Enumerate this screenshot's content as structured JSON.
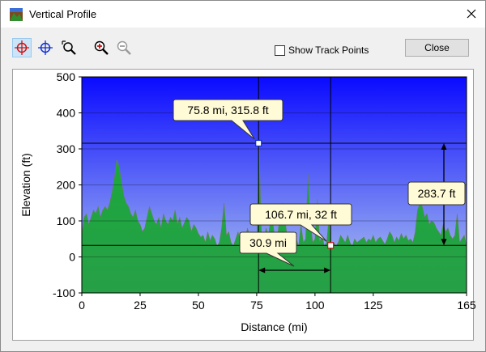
{
  "window": {
    "title": "Vertical Profile"
  },
  "toolbar": {
    "show_track_points_label": "Show Track Points",
    "close_label": "Close"
  },
  "chart_data": {
    "type": "area",
    "xlabel": "Distance   (mi)",
    "ylabel": "Elevation (ft)",
    "xlim": [
      0,
      165
    ],
    "ylim": [
      -100,
      500
    ],
    "x_ticks": [
      "0",
      "25",
      "50",
      "75",
      "100",
      "125",
      "165"
    ],
    "x_tick_values": [
      0,
      25,
      50,
      75,
      100,
      125,
      165
    ],
    "y_ticks": [
      "500",
      "400",
      "300",
      "200",
      "100",
      "0",
      "-100"
    ],
    "y_tick_values": [
      500,
      400,
      300,
      200,
      100,
      0,
      -100
    ],
    "grid": true,
    "colors": {
      "sky_top": "#0000ff",
      "sky_bottom": "#a9c8ee",
      "terrain": "#1e9e3e",
      "terrain_line": "#5a7a4a"
    },
    "series": [
      {
        "x": [
          0,
          1,
          2,
          3,
          4,
          5,
          6,
          7,
          8,
          9,
          10,
          11,
          12,
          13,
          14,
          15,
          16,
          17,
          18,
          19,
          20,
          21,
          22,
          23,
          24,
          25,
          26,
          27,
          28,
          29,
          30,
          31,
          32,
          33,
          34,
          35,
          36,
          37,
          38,
          39,
          40,
          41,
          42,
          43,
          44,
          45,
          46,
          47,
          48,
          49,
          50,
          51,
          52,
          53,
          54,
          55,
          56,
          57,
          58,
          59,
          60,
          61,
          62,
          63,
          64,
          65,
          66,
          67,
          68,
          69,
          70,
          71,
          72,
          73,
          74,
          75,
          76,
          77,
          78,
          79,
          80,
          81,
          82,
          83,
          84,
          85,
          86,
          87,
          88,
          89,
          90,
          91,
          92,
          93,
          94,
          95,
          96,
          97,
          98,
          99,
          100,
          101,
          102,
          103,
          104,
          105,
          106,
          107,
          108,
          109,
          110,
          111,
          112,
          113,
          114,
          115,
          116,
          117,
          118,
          119,
          120,
          121,
          122,
          123,
          124,
          125,
          126,
          127,
          128,
          129,
          130,
          131,
          132,
          133,
          134,
          135,
          136,
          137,
          138,
          139,
          140,
          141,
          142,
          143,
          144,
          145,
          146,
          147,
          148,
          149,
          150,
          151,
          152,
          153,
          154,
          155,
          156,
          157,
          158,
          159,
          160,
          161,
          162,
          163,
          164,
          165
        ],
        "y": [
          60,
          110,
          120,
          90,
          110,
          130,
          120,
          140,
          110,
          130,
          140,
          130,
          150,
          180,
          220,
          270,
          250,
          210,
          170,
          150,
          140,
          120,
          110,
          130,
          100,
          90,
          70,
          80,
          110,
          140,
          120,
          100,
          90,
          110,
          80,
          120,
          100,
          90,
          110,
          100,
          130,
          90,
          110,
          80,
          95,
          110,
          100,
          70,
          90,
          80,
          65,
          55,
          60,
          40,
          70,
          45,
          60,
          50,
          30,
          40,
          80,
          150,
          60,
          70,
          40,
          30,
          50,
          70,
          40,
          60,
          40,
          80,
          60,
          50,
          40,
          30,
          320,
          60,
          40,
          80,
          60,
          100,
          90,
          40,
          60,
          120,
          150,
          110,
          60,
          70,
          40,
          60,
          50,
          30,
          90,
          40,
          50,
          230,
          100,
          40,
          50,
          160,
          40,
          60,
          30,
          40,
          110,
          30,
          40,
          30,
          40,
          60,
          50,
          40,
          60,
          40,
          30,
          50,
          40,
          45,
          50,
          55,
          40,
          50,
          45,
          60,
          40,
          50,
          55,
          45,
          35,
          50,
          70,
          60,
          40,
          55,
          45,
          65,
          50,
          60,
          45,
          50,
          40,
          70,
          130,
          150,
          140,
          110,
          120,
          90,
          100,
          95,
          80,
          70,
          60,
          90,
          70,
          80,
          60,
          50,
          60,
          120,
          40,
          50,
          60,
          30
        ]
      }
    ],
    "annotations": {
      "point1_label": "75.8 mi, 315.8 ft",
      "point1": {
        "x": 75.8,
        "y": 315.8
      },
      "point2_label": "106.7 mi, 32 ft",
      "point2": {
        "x": 106.7,
        "y": 32
      },
      "dx_label": "30.9 mi",
      "dy_label": "283.7 ft"
    }
  }
}
